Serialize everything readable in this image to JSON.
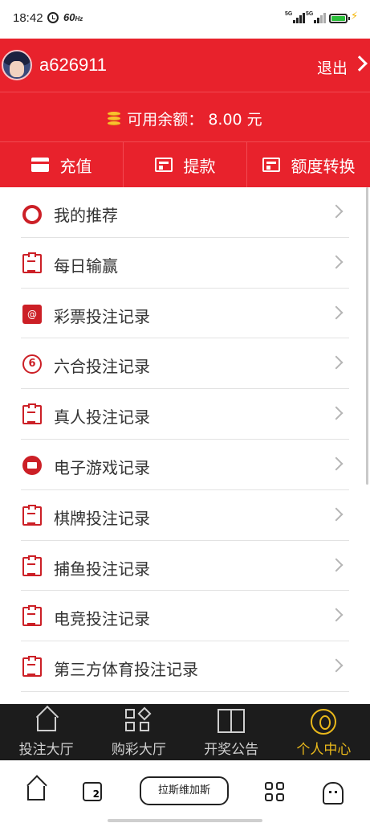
{
  "status_bar": {
    "time": "18:42",
    "refresh_rate": "60",
    "refresh_unit": "Hz",
    "signal_1": "5G",
    "signal_2": "5G"
  },
  "header": {
    "username": "a626911",
    "logout_label": "退出",
    "balance_text": "可用余额：  8.00 元"
  },
  "actions": [
    {
      "label": "充值",
      "icon": "card-icon"
    },
    {
      "label": "提款",
      "icon": "atm-icon"
    },
    {
      "label": "额度转换",
      "icon": "atm-icon"
    }
  ],
  "menu": [
    {
      "label": "我的推荐",
      "icon": "ring-icon"
    },
    {
      "label": "每日输赢",
      "icon": "report-icon"
    },
    {
      "label": "彩票投注记录",
      "icon": "lottery-icon"
    },
    {
      "label": "六合投注记录",
      "icon": "six-badge-icon",
      "icon_text": "6"
    },
    {
      "label": "真人投注记录",
      "icon": "clipboard-icon"
    },
    {
      "label": "电子游戏记录",
      "icon": "folder-icon"
    },
    {
      "label": "棋牌投注记录",
      "icon": "clipboard-icon"
    },
    {
      "label": "捕鱼投注记录",
      "icon": "clipboard-icon"
    },
    {
      "label": "电竞投注记录",
      "icon": "clipboard-icon"
    },
    {
      "label": "第三方体育投注记录",
      "icon": "clipboard-icon"
    }
  ],
  "tabbar": [
    {
      "label": "投注大厅",
      "icon": "home-icon",
      "active": false
    },
    {
      "label": "购彩大厅",
      "icon": "grid-icon",
      "active": false
    },
    {
      "label": "开奖公告",
      "icon": "gift-icon",
      "active": false
    },
    {
      "label": "个人中心",
      "icon": "user-icon",
      "active": true
    }
  ],
  "system_nav": {
    "pill_label": "拉斯维加斯",
    "recent_badge": "2"
  },
  "colors": {
    "primary_red": "#e8222c",
    "icon_red": "#cc1f26",
    "tab_active": "#e9b81b",
    "tabbar_bg": "#1c1c1c"
  }
}
